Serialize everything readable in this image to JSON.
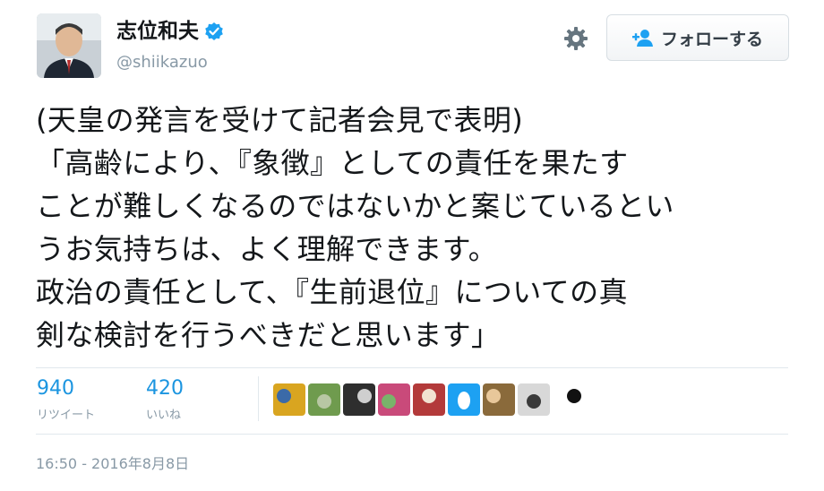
{
  "user": {
    "display_name": "志位和夫",
    "handle": "@shiikazuo",
    "verified": true
  },
  "follow_button": {
    "label": "フォローする",
    "icon": "add-user-icon"
  },
  "settings_icon": "gear-icon",
  "tweet": {
    "text": "(天皇の発言を受けて記者会見で表明)\n「高齢により、『象徴』としての責任を果たす\nことが難しくなるのではないかと案じているとい\nうお気持ちは、よく理解できます。\n政治の責任として、『生前退位』についての真\n剣な検討を行うべきだと思います」"
  },
  "stats": {
    "retweets": {
      "count": "940",
      "label": "リツイート"
    },
    "likes": {
      "count": "420",
      "label": "いいね"
    }
  },
  "likers": [
    {
      "name": "liker-avatar-1",
      "color": "#d9a520",
      "accent": "#3b6aa8"
    },
    {
      "name": "liker-avatar-2",
      "color": "#6f9b4e",
      "accent": "#b8c7a4"
    },
    {
      "name": "liker-avatar-3",
      "color": "#2e2e2e",
      "accent": "#cfcfcf"
    },
    {
      "name": "liker-avatar-4",
      "color": "#c94a7a",
      "accent": "#79b36a"
    },
    {
      "name": "liker-avatar-5",
      "color": "#b33a3a",
      "accent": "#f1e2d0"
    },
    {
      "name": "liker-avatar-6",
      "color": "#1da1f2",
      "accent": "#ffffff"
    },
    {
      "name": "liker-avatar-7",
      "color": "#8a6a3b",
      "accent": "#e8c79a"
    },
    {
      "name": "liker-avatar-8",
      "color": "#d8d8d8",
      "accent": "#3a3a3a"
    },
    {
      "name": "liker-avatar-9",
      "color": "#ffffff",
      "accent": "#111111"
    }
  ],
  "timestamp": "16:50 - 2016年8月8日",
  "colors": {
    "link_blue": "#1b95e0",
    "secondary_text": "#8899a6",
    "verified_blue": "#1da1f2"
  }
}
